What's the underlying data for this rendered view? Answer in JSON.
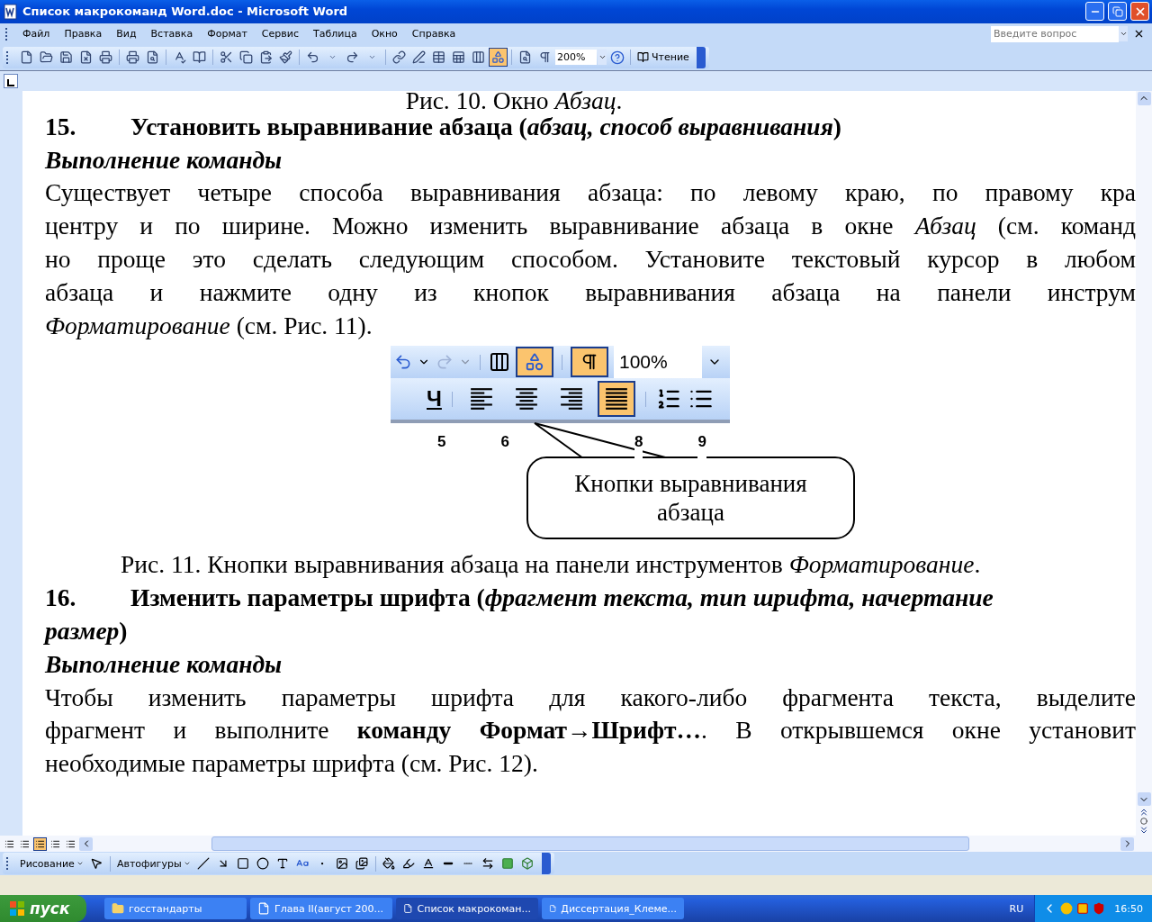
{
  "window": {
    "title": "Список макрокоманд Word.doc - Microsoft Word"
  },
  "menu": [
    "Файл",
    "Правка",
    "Вид",
    "Вставка",
    "Формат",
    "Сервис",
    "Таблица",
    "Окно",
    "Справка"
  ],
  "help_search": {
    "placeholder": "Введите вопрос"
  },
  "toolbar": {
    "zoom": "200%",
    "reading_button": "Чтение",
    "drawing_pressed": true
  },
  "document": {
    "top_caption": "Рис. 10. Окно *Абзац*.",
    "section_15": {
      "number": "15.",
      "title": "Установить выравнивание абзаца (*абзац, способ выравнивания*)",
      "subheading": "Выполнение команды",
      "lines": [
        "Существует четыре способа выравнивания абзаца: по левому краю, по правому кра",
        "центру и по ширине. Можно изменить выравнивание абзаца в окне *Абзац* (см. команд",
        "но проще это сделать следующим способом. Установите текстовый курсор в любом",
        "абзаца и нажмите одну из кнопок выравнивания абзаца на панели инструм",
        "*Форматирование* (см. Рис. 11)."
      ]
    },
    "figure": {
      "zoom": "100%",
      "underline_key": "Ч",
      "buttons": [
        {
          "kind": "align-left",
          "selected": false
        },
        {
          "kind": "align-center",
          "selected": false
        },
        {
          "kind": "align-right",
          "selected": false
        },
        {
          "kind": "align-justify",
          "selected": true
        }
      ],
      "ruler_labels": [
        "5",
        "6",
        "8",
        "9"
      ],
      "callout": "Кнопки выравнивания абзаца"
    },
    "caption": "Рис. 11. Кнопки выравнивания абзаца на панели инструментов *Форматирование*.",
    "section_16": {
      "number": "16.",
      "title_lines": [
        "Изменить параметры шрифта (*фрагмент текста, тип шрифта, начертание*",
        "*размер*)"
      ],
      "subheading": "Выполнение команды",
      "lines": [
        "Чтобы изменить параметры шрифта для какого-либо фрагмента текста, выделите",
        "фрагмент и выполните **команду Формат→Шрифт…**. В открывшемся окне установит",
        "необходимые параметры шрифта (см. Рис. 12)."
      ]
    }
  },
  "view_buttons": [
    {
      "selected": false
    },
    {
      "selected": false
    },
    {
      "selected": true
    },
    {
      "selected": false
    },
    {
      "selected": false
    }
  ],
  "drawing_toolbar": {
    "draw_menu": "Рисование",
    "autoshapes_menu": "Автофигуры"
  },
  "taskbar": {
    "start": "пуск",
    "tasks": [
      {
        "label": "госстандарты",
        "kind": "folder",
        "selected": false
      },
      {
        "label": "Глава II(август 200...",
        "kind": "word",
        "selected": false
      },
      {
        "label": "Список макрокоман...",
        "kind": "word",
        "selected": true
      },
      {
        "label": "Диссертация_Клеме...",
        "kind": "word",
        "selected": false
      }
    ],
    "language": "RU",
    "clock": "16:50"
  }
}
